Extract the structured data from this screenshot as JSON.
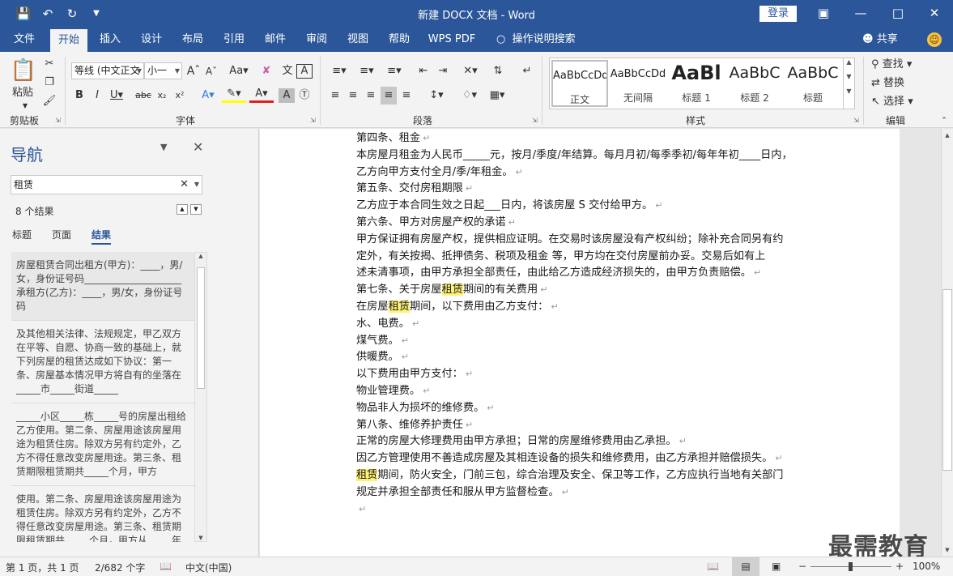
{
  "window": {
    "title": "新建 DOCX 文档 - Word",
    "login_label": "登录"
  },
  "quick_access": [
    "save-icon",
    "undo-icon",
    "redo-icon",
    "customize-icon"
  ],
  "tabs": [
    {
      "label": "文件"
    },
    {
      "label": "开始"
    },
    {
      "label": "插入"
    },
    {
      "label": "设计"
    },
    {
      "label": "布局"
    },
    {
      "label": "引用"
    },
    {
      "label": "邮件"
    },
    {
      "label": "审阅"
    },
    {
      "label": "视图"
    },
    {
      "label": "帮助"
    },
    {
      "label": "WPS PDF"
    }
  ],
  "tell_me": "操作说明搜索",
  "share_label": "共享",
  "ribbon": {
    "clipboard": {
      "paste_label": "粘贴",
      "group_label": "剪贴板"
    },
    "font": {
      "font_name": "等线 (中文正文",
      "font_size": "小一",
      "group_label": "字体"
    },
    "paragraph": {
      "group_label": "段落"
    },
    "styles": {
      "group_label": "样式",
      "items": [
        {
          "sample": "AaBbCcDd",
          "name": "正文"
        },
        {
          "sample": "AaBbCcDd",
          "name": "无间隔"
        },
        {
          "sample": "AaBl",
          "name": "标题 1"
        },
        {
          "sample": "AaBbC",
          "name": "标题 2"
        },
        {
          "sample": "AaBbC",
          "name": "标题"
        }
      ]
    },
    "editing": {
      "find_label": "查找",
      "replace_label": "替换",
      "select_label": "选择",
      "group_label": "编辑"
    }
  },
  "nav": {
    "title": "导航",
    "search_value": "租赁",
    "result_count": "8 个结果",
    "tabs": [
      "标题",
      "页面",
      "结果"
    ],
    "results": [
      "房屋租赁合同出租方(甲方)：____，男/女，身份证号码____________________承租方(乙方)：____，男/女，身份证号码",
      "及其他相关法律、法规规定，甲乙双方在平等、自愿、协商一致的基础上，就下列房屋的租赁达成如下协议：第一条、房屋基本情况甲方将自有的坐落在_____市_____街道_____",
      "_____小区_____栋_____号的房屋出租给乙方使用。第二条、房屋用途该房屋用途为租赁住房。除双方另有约定外，乙方不得任意改变房屋用途。第三条、租赁期限租赁期共_____个月，甲方",
      "使用。第二条、房屋用途该房屋用途为租赁住房。除双方另有约定外，乙方不得任意改变房屋用途。第三条、租赁期限租赁期共_____个月，甲方从_____年_____月_____日起将出租房屋交付"
    ]
  },
  "document": {
    "lines": [
      {
        "text": "第四条、租金"
      },
      {
        "text": "本房屋月租金为人民币_____元，按月/季度/年结算。每月月初/每季季初/每年年初____日内，",
        "nomark": true
      },
      {
        "text": "乙方向甲方支付全月/季/年租金。"
      },
      {
        "text": "第五条、交付房租期限"
      },
      {
        "text": "乙方应于本合同生效之日起___日内，将该房屋 S 交付给甲方。"
      },
      {
        "text": "第六条、甲方对房屋产权的承诺"
      },
      {
        "text": "甲方保证拥有房屋产权，提供相应证明。在交易时该房屋没有产权纠纷；除补充合同另有约",
        "nomark": true
      },
      {
        "text": "定外，有关按揭、抵押债务、税项及租金        等，甲方均在交付房屋前办妥。交易后如有上",
        "nomark": true
      },
      {
        "text": "述未清事项，由甲方承担全部责任，由此给乙方造成经济损失的，由甲方负责赔偿。"
      },
      {
        "pre": "第七条、关于房屋",
        "hl": "租赁",
        "post": "期间的有关费用"
      },
      {
        "pre": "在房屋",
        "hl": "租赁",
        "post": "期间，以下费用由乙方支付："
      },
      {
        "text": "水、电费。"
      },
      {
        "text": "煤气费。"
      },
      {
        "text": "供暖费。"
      },
      {
        "text": "以下费用由甲方支付："
      },
      {
        "text": "物业管理费。"
      },
      {
        "text": "物品非人为损坏的维修费。"
      },
      {
        "text": "第八条、维修养护责任"
      },
      {
        "text": "正常的房屋大修理费用由甲方承担；日常的房屋维修费用由乙承担。"
      },
      {
        "text": "因乙方管理使用不善造成房屋及其相连设备的损失和维修费用，由乙方承担并赔偿损失。"
      },
      {
        "pre": "",
        "hl": "租赁",
        "post": "期间，防火安全，门前三包，综合治理及安全、保卫等工作，乙方应执行当地有关部门",
        "nomark": true
      },
      {
        "text": "规定并承担全部责任和服从甲方监督检查。"
      },
      {
        "text": ""
      }
    ]
  },
  "status": {
    "page": "第 1 页，共 1 页",
    "words": "2/682 个字",
    "language": "中文(中国)",
    "zoom": "100%"
  },
  "watermark": "最需教育"
}
